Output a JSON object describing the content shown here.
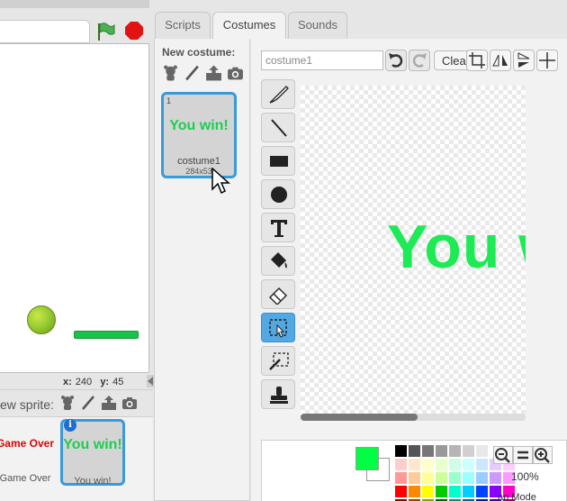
{
  "stage": {
    "coords": {
      "x_label": "x:",
      "x_value": "240",
      "y_label": "y:",
      "y_value": "45"
    }
  },
  "sprites": {
    "header_label": "ew sprite:",
    "items": [
      {
        "thumb_text": "Game Over",
        "name": "Game Over",
        "thumb_color": "#e00000"
      },
      {
        "thumb_text": "You win!",
        "name": "You win!",
        "thumb_color": "#1ccf4f",
        "info_badge": "i"
      }
    ]
  },
  "tabs": [
    {
      "label": "Scripts"
    },
    {
      "label": "Costumes"
    },
    {
      "label": "Sounds"
    }
  ],
  "costumes": {
    "new_label": "New costume:",
    "items": [
      {
        "number": "1",
        "thumb_text": "You win!",
        "name": "costume1",
        "size": "284x53"
      }
    ]
  },
  "editor": {
    "name_value": "costume1",
    "clear_label": "Clear",
    "canvas_text": "You win!",
    "canvas_text_color": "#1eea55",
    "zoom_label": "100%",
    "mode_label": "ap Mode",
    "primary_color": "#00ff44",
    "secondary_color": "#ffffff",
    "palette": [
      "#000000",
      "#555555",
      "#777777",
      "#999999",
      "#b5b5b5",
      "#d0d0d0",
      "#e8e8e8",
      "#ffffff",
      "#f0f0f0",
      "#ffcccc",
      "#ffe6cc",
      "#ffffcc",
      "#e6ffcc",
      "#ccffe6",
      "#ccffff",
      "#cce6ff",
      "#e6ccff",
      "#ffccff",
      "#ff9999",
      "#ffcc99",
      "#ffff99",
      "#ccff99",
      "#99ffcc",
      "#99ffff",
      "#99ccff",
      "#cc99ff",
      "#ff99ff",
      "#ff0000",
      "#ff8800",
      "#ffff00",
      "#00cc00",
      "#00ffcc",
      "#00ccff",
      "#0044ff",
      "#8800ff",
      "#ff00cc",
      "#990000",
      "#994400",
      "#999900",
      "#006600",
      "#009966",
      "#006699",
      "#001f99",
      "#440099",
      "#990066"
    ],
    "tools": [
      "brush-icon",
      "line-icon",
      "rectangle-icon",
      "ellipse-icon",
      "text-icon",
      "fill-bucket-icon",
      "eraser-icon",
      "select-icon",
      "magic-wand-icon",
      "stamp-icon"
    ]
  }
}
